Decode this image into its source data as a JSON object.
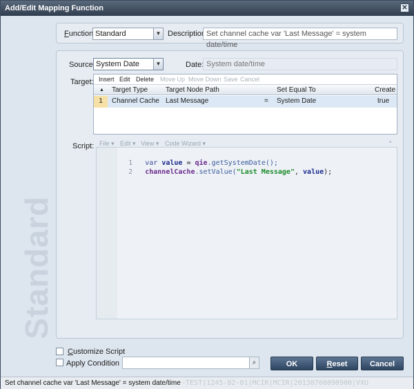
{
  "window": {
    "title": "Add/Edit Mapping Function",
    "close_glyph": "✕",
    "watermark": "Standard"
  },
  "function_row": {
    "function_label_u": "F",
    "function_label_rest": "unction:",
    "function_value": "Standard",
    "description_label": "Description:",
    "description_value": "Set channel cache var 'Last Message' = system date/time"
  },
  "source_row": {
    "source_label": "Source:",
    "source_value": "System Date",
    "date_label": "Date:",
    "date_value": "System date/time"
  },
  "target": {
    "label": "Target:",
    "toolbar": [
      "Insert",
      "Edit",
      "Delete",
      "Move Up",
      "Move Down",
      "Save",
      "Cancel"
    ],
    "sort_glyph": "▲",
    "columns": [
      "Target Type",
      "Target Node Path",
      "Set Equal To",
      "Create"
    ],
    "rows": [
      {
        "num": "1",
        "type": "Channel Cache",
        "path": "Last Message",
        "op": "=",
        "value": "System Date",
        "create": "true"
      }
    ]
  },
  "script": {
    "label": "Script:",
    "toolbar": [
      "File ▾",
      "Edit ▾",
      "View ▾",
      "Code Wizard ▾"
    ],
    "maximize_glyph": "▫",
    "lines": [
      {
        "num": "1",
        "t1": "var",
        "t2": "value",
        "t3": " = ",
        "t4": "qie",
        "t5": ".getSystemDate();"
      },
      {
        "num": "2",
        "t1": "channelCache",
        "t2": ".setValue(",
        "t3": "\"Last Message\"",
        "t4": ", ",
        "t5": "value",
        "t6": ");"
      }
    ]
  },
  "options": {
    "customize_u": "C",
    "customize_rest": "ustomize Script",
    "apply_condition": "Apply Condition",
    "condition_value": "",
    "search_icon_glyph": "⌕"
  },
  "buttons": {
    "ok": "OK",
    "reset_u": "R",
    "reset_rest": "eset",
    "cancel": "Cancel"
  },
  "statusbar": {
    "message": "Set channel cache var 'Last Message' = system date/time",
    "background_text": "nkLogic-TEST|1245-82-01|MCIR|MCIR|20130708090900|VXU"
  },
  "colors": {
    "title_bar": "#2f3d4e",
    "button": "#3d5570",
    "selected_row": "#dce8f5"
  }
}
